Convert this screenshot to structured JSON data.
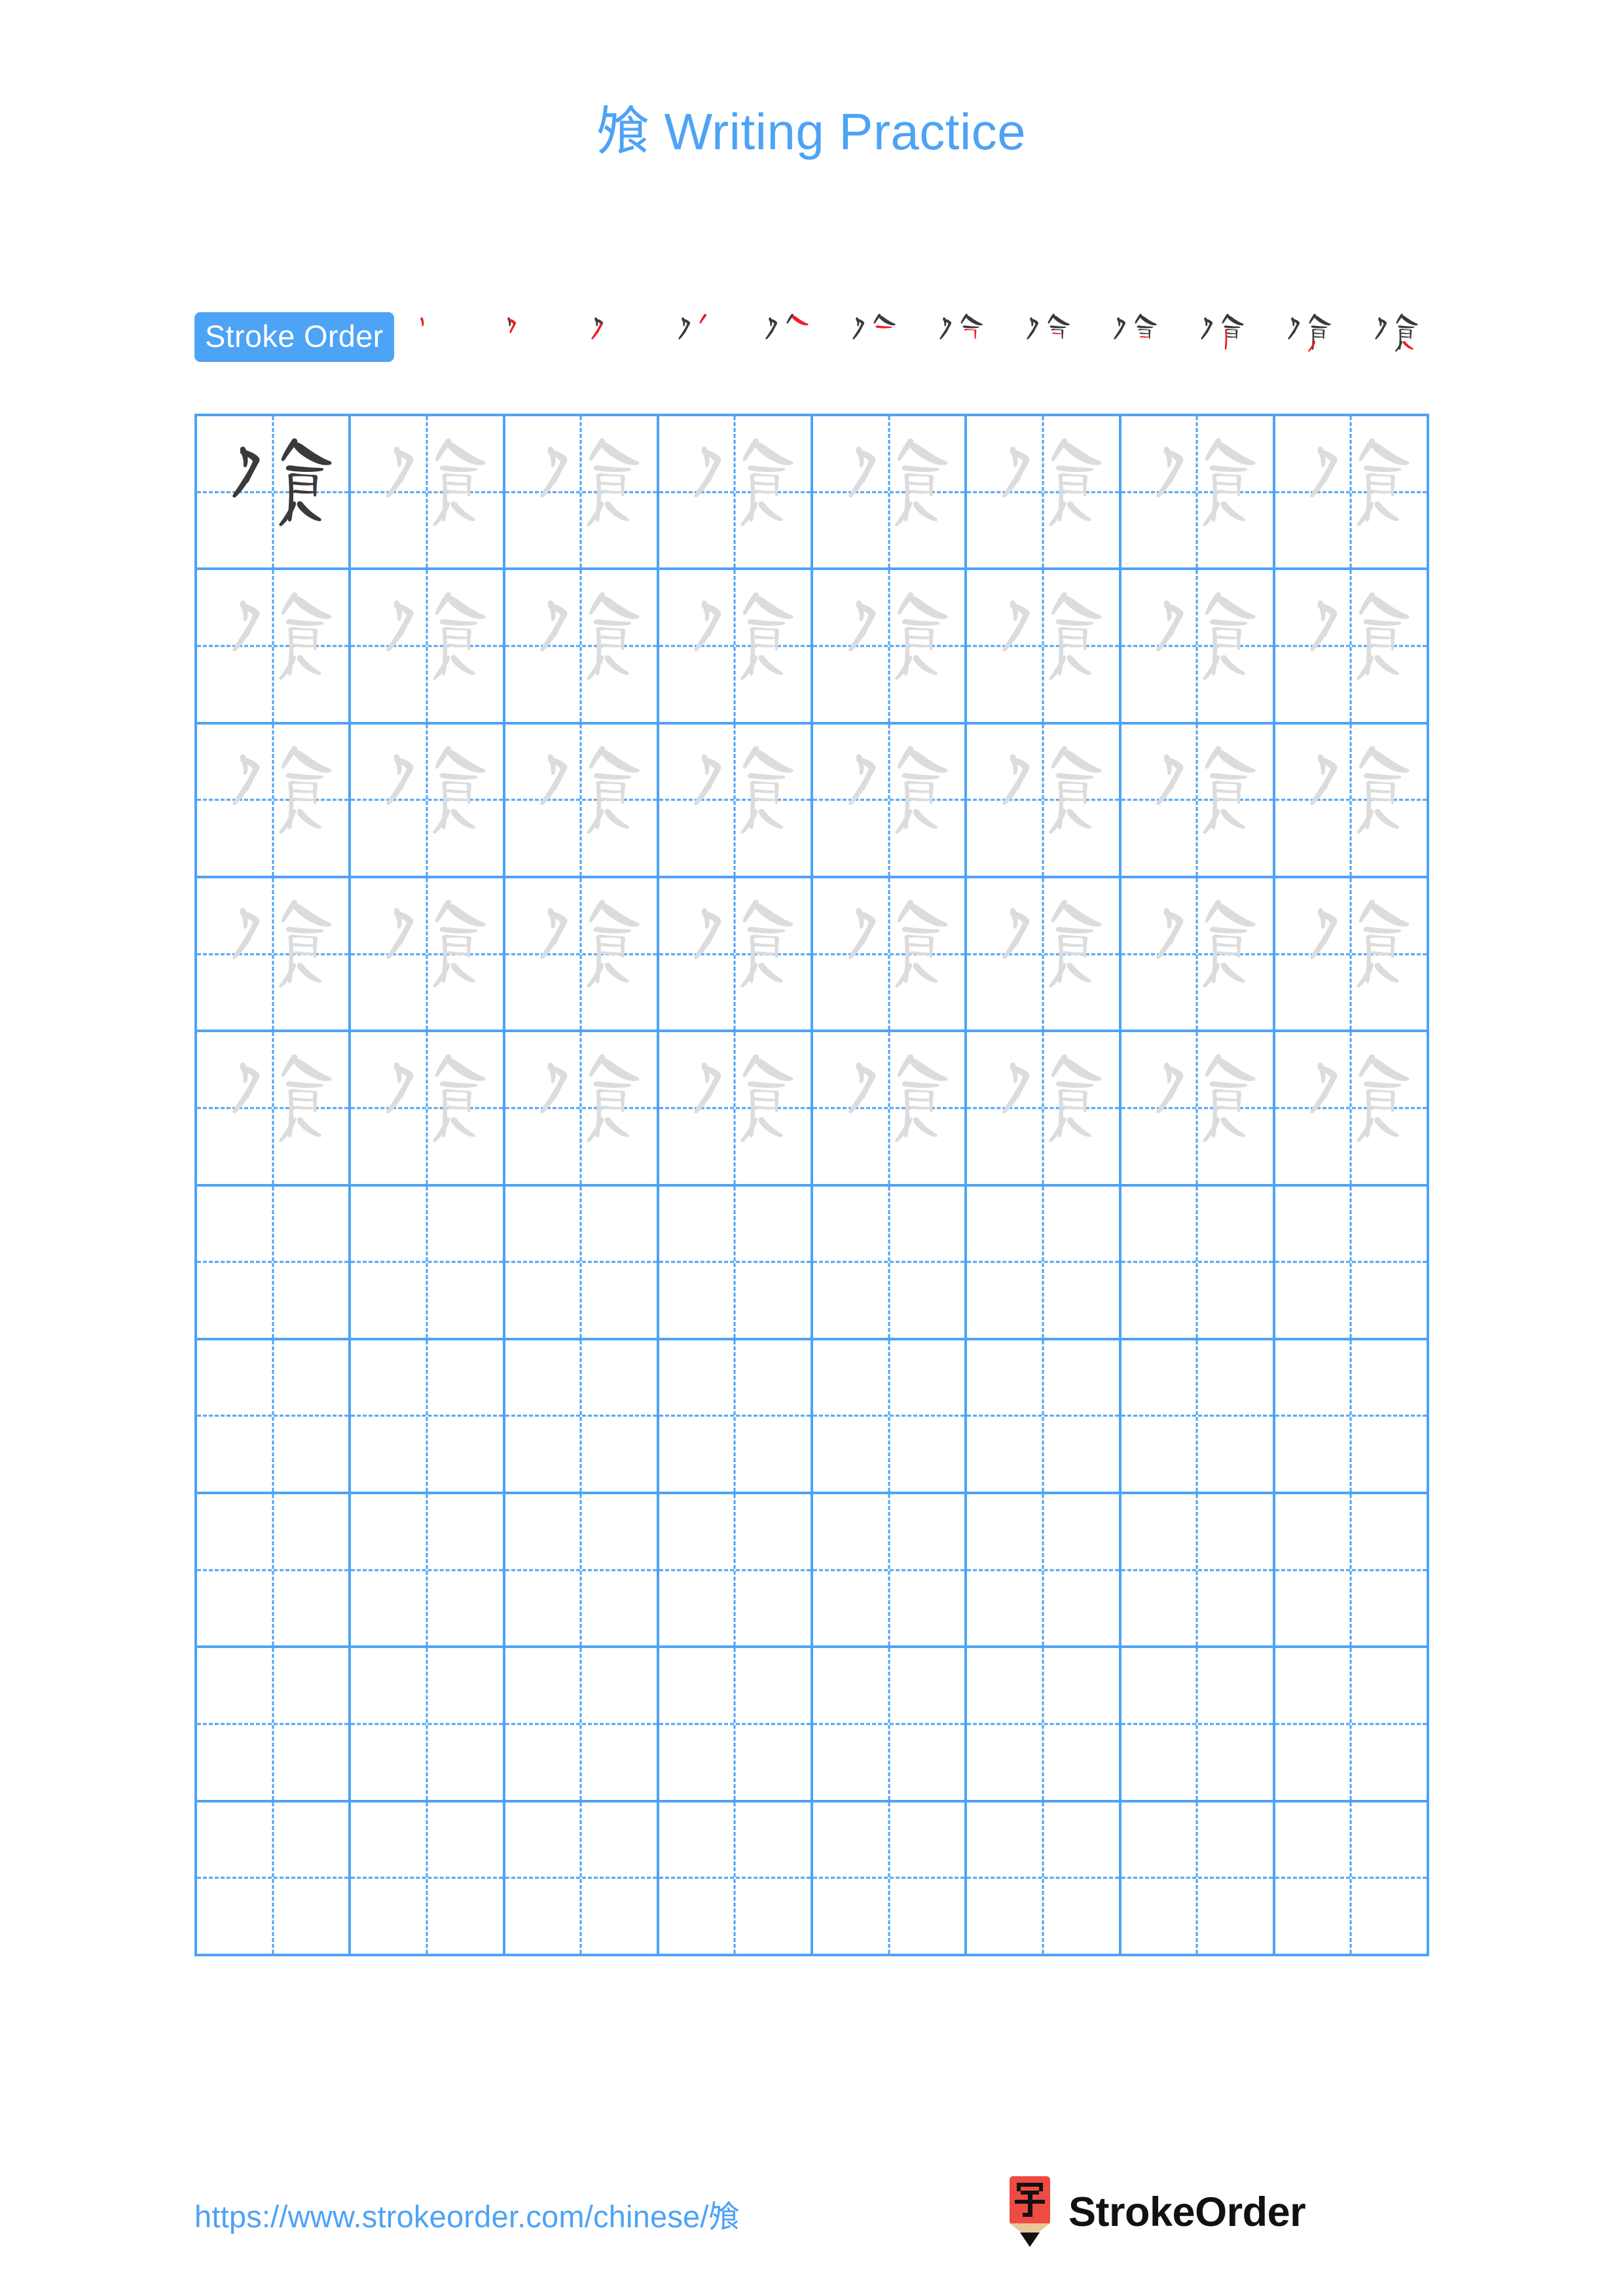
{
  "page": {
    "background_color": "#ffffff",
    "accent_color": "#4da3f5",
    "character": "飧",
    "stroke_count": 12
  },
  "title": {
    "character": "飧",
    "text": " Writing Practice",
    "full": "飧 Writing Practice",
    "color": "#4da3f5"
  },
  "stroke_order": {
    "badge_label": "Stroke Order",
    "badge_bg": "#4da3f5",
    "badge_text_color": "#ffffff",
    "new_stroke_color": "#ee1b24",
    "prior_stroke_color": "#3a3a3c",
    "steps": [
      {
        "index": 1,
        "strokes_shown": 1,
        "name": "stroke-step-1"
      },
      {
        "index": 2,
        "strokes_shown": 2,
        "name": "stroke-step-2"
      },
      {
        "index": 3,
        "strokes_shown": 3,
        "name": "stroke-step-3"
      },
      {
        "index": 4,
        "strokes_shown": 4,
        "name": "stroke-step-4"
      },
      {
        "index": 5,
        "strokes_shown": 5,
        "name": "stroke-step-5"
      },
      {
        "index": 6,
        "strokes_shown": 6,
        "name": "stroke-step-6"
      },
      {
        "index": 7,
        "strokes_shown": 7,
        "name": "stroke-step-7"
      },
      {
        "index": 8,
        "strokes_shown": 8,
        "name": "stroke-step-8"
      },
      {
        "index": 9,
        "strokes_shown": 9,
        "name": "stroke-step-9"
      },
      {
        "index": 10,
        "strokes_shown": 10,
        "name": "stroke-step-10"
      },
      {
        "index": 11,
        "strokes_shown": 11,
        "name": "stroke-step-11"
      },
      {
        "index": 12,
        "strokes_shown": 12,
        "name": "stroke-step-12"
      }
    ]
  },
  "grid": {
    "columns": 8,
    "rows": 10,
    "line_color": "#4da3f5",
    "guide_style": "dashed-crosshair",
    "model_char_color": "#3a3a3c",
    "trace_char_color": "#dcdcdc",
    "cells": [
      [
        "model",
        "trace",
        "trace",
        "trace",
        "trace",
        "trace",
        "trace",
        "trace"
      ],
      [
        "trace",
        "trace",
        "trace",
        "trace",
        "trace",
        "trace",
        "trace",
        "trace"
      ],
      [
        "trace",
        "trace",
        "trace",
        "trace",
        "trace",
        "trace",
        "trace",
        "trace"
      ],
      [
        "trace",
        "trace",
        "trace",
        "trace",
        "trace",
        "trace",
        "trace",
        "trace"
      ],
      [
        "trace",
        "trace",
        "trace",
        "trace",
        "trace",
        "trace",
        "trace",
        "trace"
      ],
      [
        "empty",
        "empty",
        "empty",
        "empty",
        "empty",
        "empty",
        "empty",
        "empty"
      ],
      [
        "empty",
        "empty",
        "empty",
        "empty",
        "empty",
        "empty",
        "empty",
        "empty"
      ],
      [
        "empty",
        "empty",
        "empty",
        "empty",
        "empty",
        "empty",
        "empty",
        "empty"
      ],
      [
        "empty",
        "empty",
        "empty",
        "empty",
        "empty",
        "empty",
        "empty",
        "empty"
      ],
      [
        "empty",
        "empty",
        "empty",
        "empty",
        "empty",
        "empty",
        "empty",
        "empty"
      ]
    ]
  },
  "footer": {
    "url": "https://www.strokeorder.com/chinese/飧",
    "url_color": "#4da3f5",
    "brand_name": "StrokeOrder",
    "logo": {
      "type": "pencil-logo",
      "body_color": "#ee4b42",
      "wood_color": "#e8c79a",
      "tip_color": "#111111",
      "glyph": "字"
    }
  }
}
